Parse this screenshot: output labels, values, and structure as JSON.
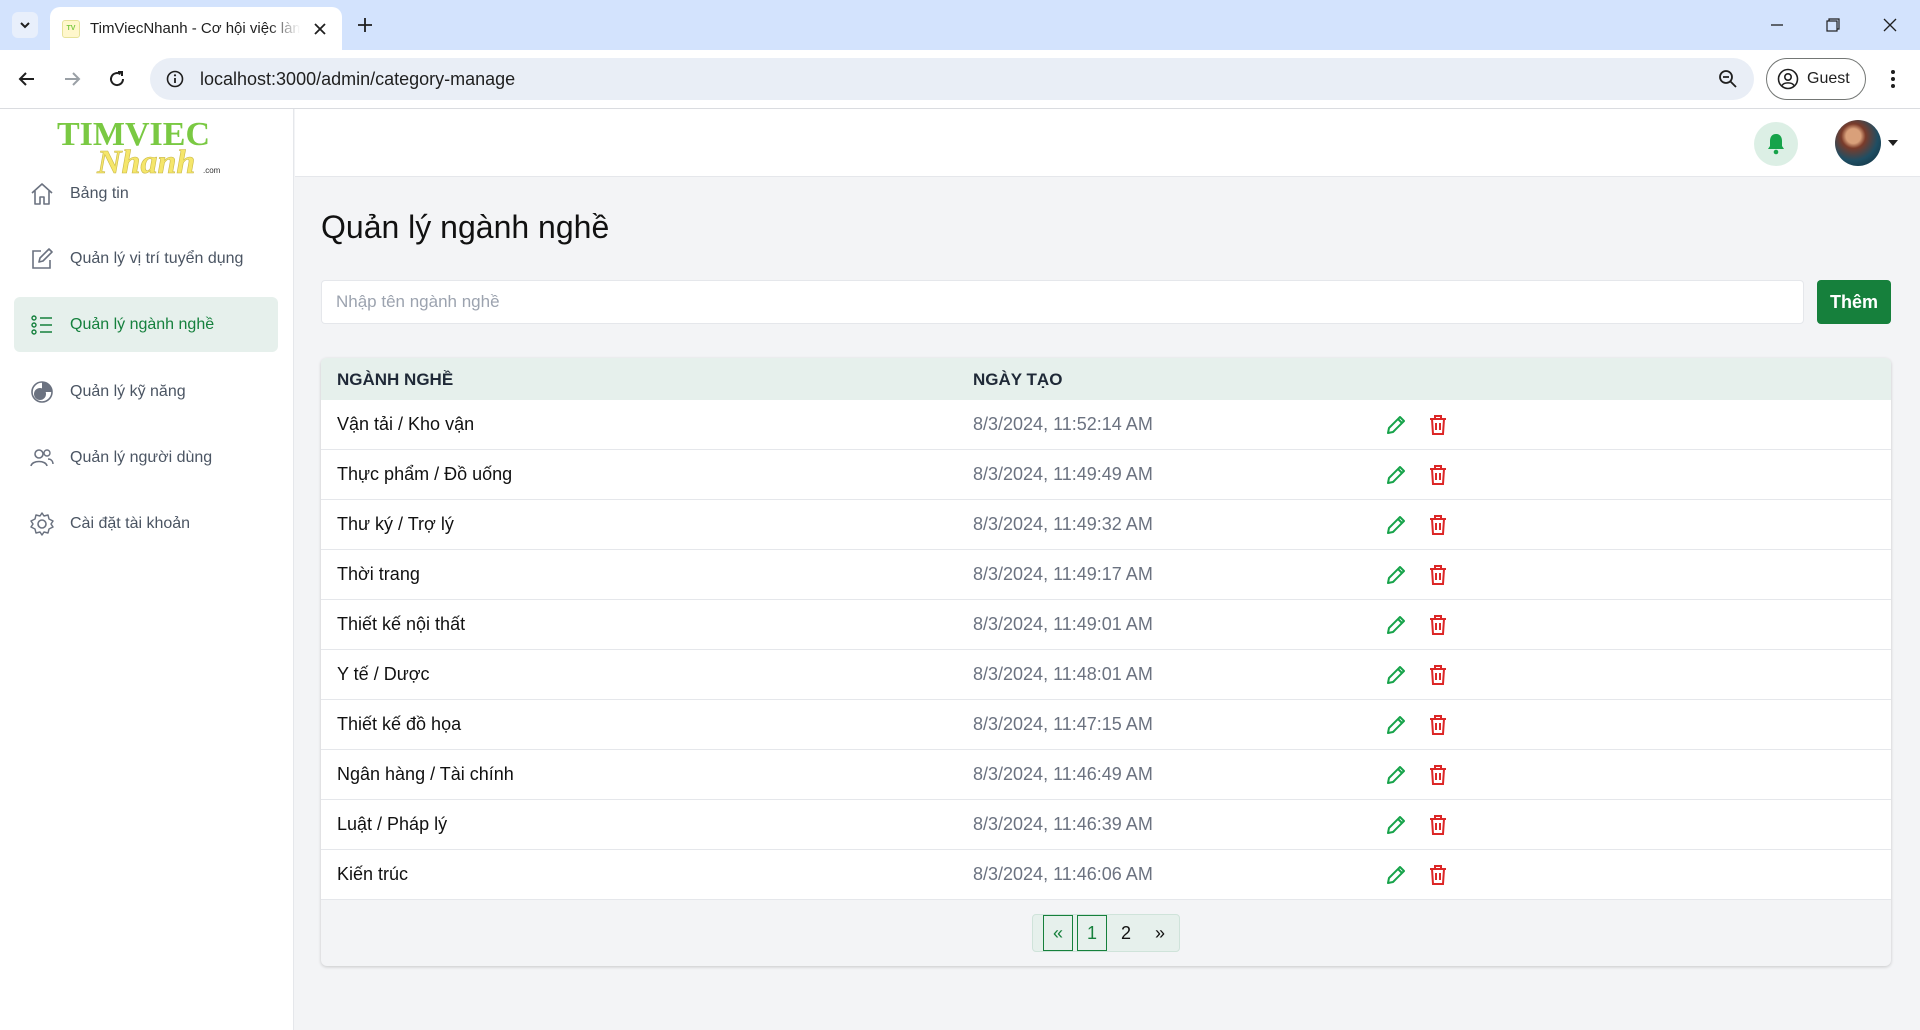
{
  "browser": {
    "tab_title": "TimViecNhanh - Cơ hội việc làm",
    "url": "localhost:3000/admin/category-manage",
    "profile_label": "Guest"
  },
  "logo": {
    "line1": "TIMVIEC",
    "line2": "Nhanh",
    "suffix": ".com"
  },
  "sidebar": {
    "items": [
      {
        "label": "Bảng tin",
        "icon": "home-icon"
      },
      {
        "label": "Quản lý vị trí tuyển dụng",
        "icon": "edit-square-icon"
      },
      {
        "label": "Quản lý ngành nghề",
        "icon": "list-icon",
        "active": true
      },
      {
        "label": "Quản lý kỹ năng",
        "icon": "chart-pie-icon"
      },
      {
        "label": "Quản lý người dùng",
        "icon": "users-icon"
      },
      {
        "label": "Cài đặt tài khoản",
        "icon": "gear-icon"
      }
    ]
  },
  "page": {
    "title": "Quản lý ngành nghề",
    "search_placeholder": "Nhập tên ngành nghề",
    "add_label": "Thêm"
  },
  "table": {
    "headers": [
      "NGÀNH NGHỀ",
      "NGÀY TẠO"
    ],
    "rows": [
      {
        "name": "Vận tải / Kho vận",
        "created": "8/3/2024, 11:52:14 AM"
      },
      {
        "name": "Thực phẩm / Đồ uống",
        "created": "8/3/2024, 11:49:49 AM"
      },
      {
        "name": "Thư ký / Trợ lý",
        "created": "8/3/2024, 11:49:32 AM"
      },
      {
        "name": "Thời trang",
        "created": "8/3/2024, 11:49:17 AM"
      },
      {
        "name": "Thiết kế nội thất",
        "created": "8/3/2024, 11:49:01 AM"
      },
      {
        "name": "Y tế / Dược",
        "created": "8/3/2024, 11:48:01 AM"
      },
      {
        "name": "Thiết kế đồ họa",
        "created": "8/3/2024, 11:47:15 AM"
      },
      {
        "name": "Ngân hàng / Tài chính",
        "created": "8/3/2024, 11:46:49 AM"
      },
      {
        "name": "Luật / Pháp lý",
        "created": "8/3/2024, 11:46:39 AM"
      },
      {
        "name": "Kiến trúc",
        "created": "8/3/2024, 11:46:06 AM"
      }
    ]
  },
  "pagination": {
    "prev": "«",
    "pages": [
      "1",
      "2"
    ],
    "current": "1",
    "next": "»"
  },
  "colors": {
    "accent": "#16803c",
    "accent_light": "#e6f0ec",
    "delete": "#dc2626"
  }
}
